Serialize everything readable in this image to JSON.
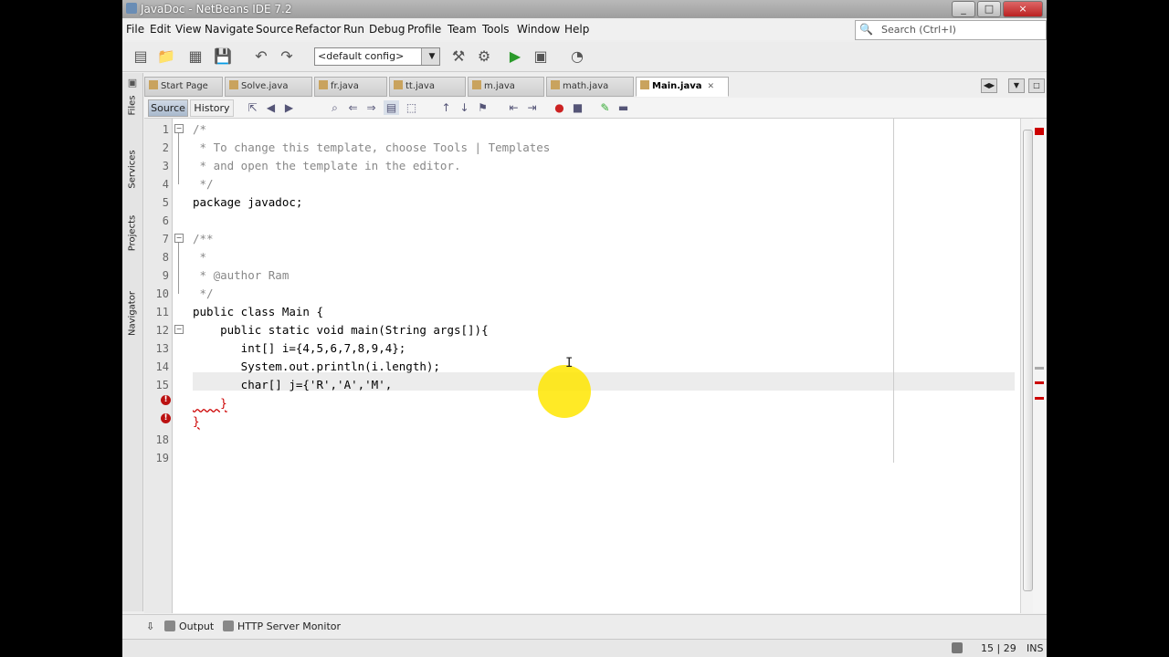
{
  "window": {
    "title": "JavaDoc - NetBeans IDE 7.2",
    "controls": [
      "_",
      "□",
      "×"
    ]
  },
  "menu": [
    "File",
    "Edit",
    "View",
    "Navigate",
    "Source",
    "Refactor",
    "Run",
    "Debug",
    "Profile",
    "Team",
    "Tools",
    "Window",
    "Help"
  ],
  "search": {
    "placeholder": "Search (Ctrl+I)"
  },
  "toolbar": {
    "config": "<default config>"
  },
  "sidebar": {
    "tabs": [
      "Files",
      "Services",
      "Projects",
      "Navigator"
    ]
  },
  "tabs": [
    {
      "label": "Start Page"
    },
    {
      "label": "Solve.java"
    },
    {
      "label": "fr.java"
    },
    {
      "label": "tt.java"
    },
    {
      "label": "m.java"
    },
    {
      "label": "math.java"
    },
    {
      "label": "Main.java",
      "active": true
    }
  ],
  "editor_toolbar": {
    "source": "Source",
    "history": "History"
  },
  "editor": {
    "line_numbers": [
      "1",
      "2",
      "3",
      "4",
      "5",
      "6",
      "7",
      "8",
      "9",
      "10",
      "11",
      "12",
      "13",
      "14",
      "15",
      "",
      "",
      "18",
      "19"
    ],
    "lines": [
      "/*",
      " * To change this template, choose Tools | Templates",
      " * and open the template in the editor.",
      " */",
      "package javadoc;",
      "",
      "/**",
      " *",
      " * @author Ram",
      " */",
      "public class Main {",
      "    public static void main(String args[]){",
      "       int[] i={4,5,6,7,8,9,4};",
      "       System.out.println(i.length);",
      "       char[] j={'R','A','M',",
      "    }",
      "}",
      "",
      ""
    ]
  },
  "bottom_tabs": [
    "Output",
    "HTTP Server Monitor"
  ],
  "status": {
    "position": "15 | 29",
    "mode": "INS"
  },
  "colors": {
    "error": "#cc1111",
    "highlight": "#ffe600",
    "comment": "#888888",
    "field": "#0a7a2d",
    "string": "#b36b00"
  }
}
